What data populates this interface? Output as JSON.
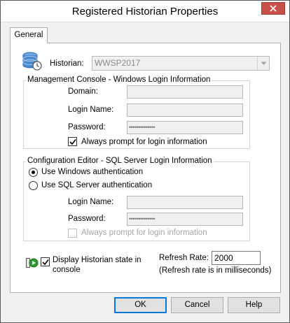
{
  "window": {
    "title": "Registered Historian Properties",
    "close_symbol": "✕"
  },
  "tabs": [
    {
      "label": "General",
      "active": true
    }
  ],
  "historian": {
    "label": "Historian:",
    "value": "WWSP2017",
    "icon": "database-icon"
  },
  "management_console": {
    "title": "Management Console - Windows Login Information",
    "domain_label": "Domain:",
    "login_name_label": "Login Name:",
    "password_label": "Password:",
    "password_mask": "••••••••••••••",
    "always_prompt_label": "Always prompt for login information",
    "always_prompt_checked": true
  },
  "config_editor": {
    "title": "Configuration Editor - SQL Server Login Information",
    "windows_auth_label": "Use Windows authentication",
    "sql_auth_label": "Use SQL Server authentication",
    "selected_auth": "windows",
    "login_name_label": "Login Name:",
    "password_label": "Password:",
    "password_mask": "••••••••••••••",
    "always_prompt_label": "Always prompt for login information",
    "always_prompt_checked": false
  },
  "display_state": {
    "label_line1": "Display Historian state in",
    "label_line2": "console",
    "checked": true,
    "icon": "play-status-icon"
  },
  "refresh": {
    "label": "Refresh Rate:",
    "value": "2000",
    "note": "(Refresh rate is in milliseconds)"
  },
  "buttons": {
    "ok": "OK",
    "cancel": "Cancel",
    "help": "Help"
  },
  "colors": {
    "close_button": "#c7504a",
    "default_button_border": "#0078d7",
    "disabled_text": "#a6a6a6"
  }
}
